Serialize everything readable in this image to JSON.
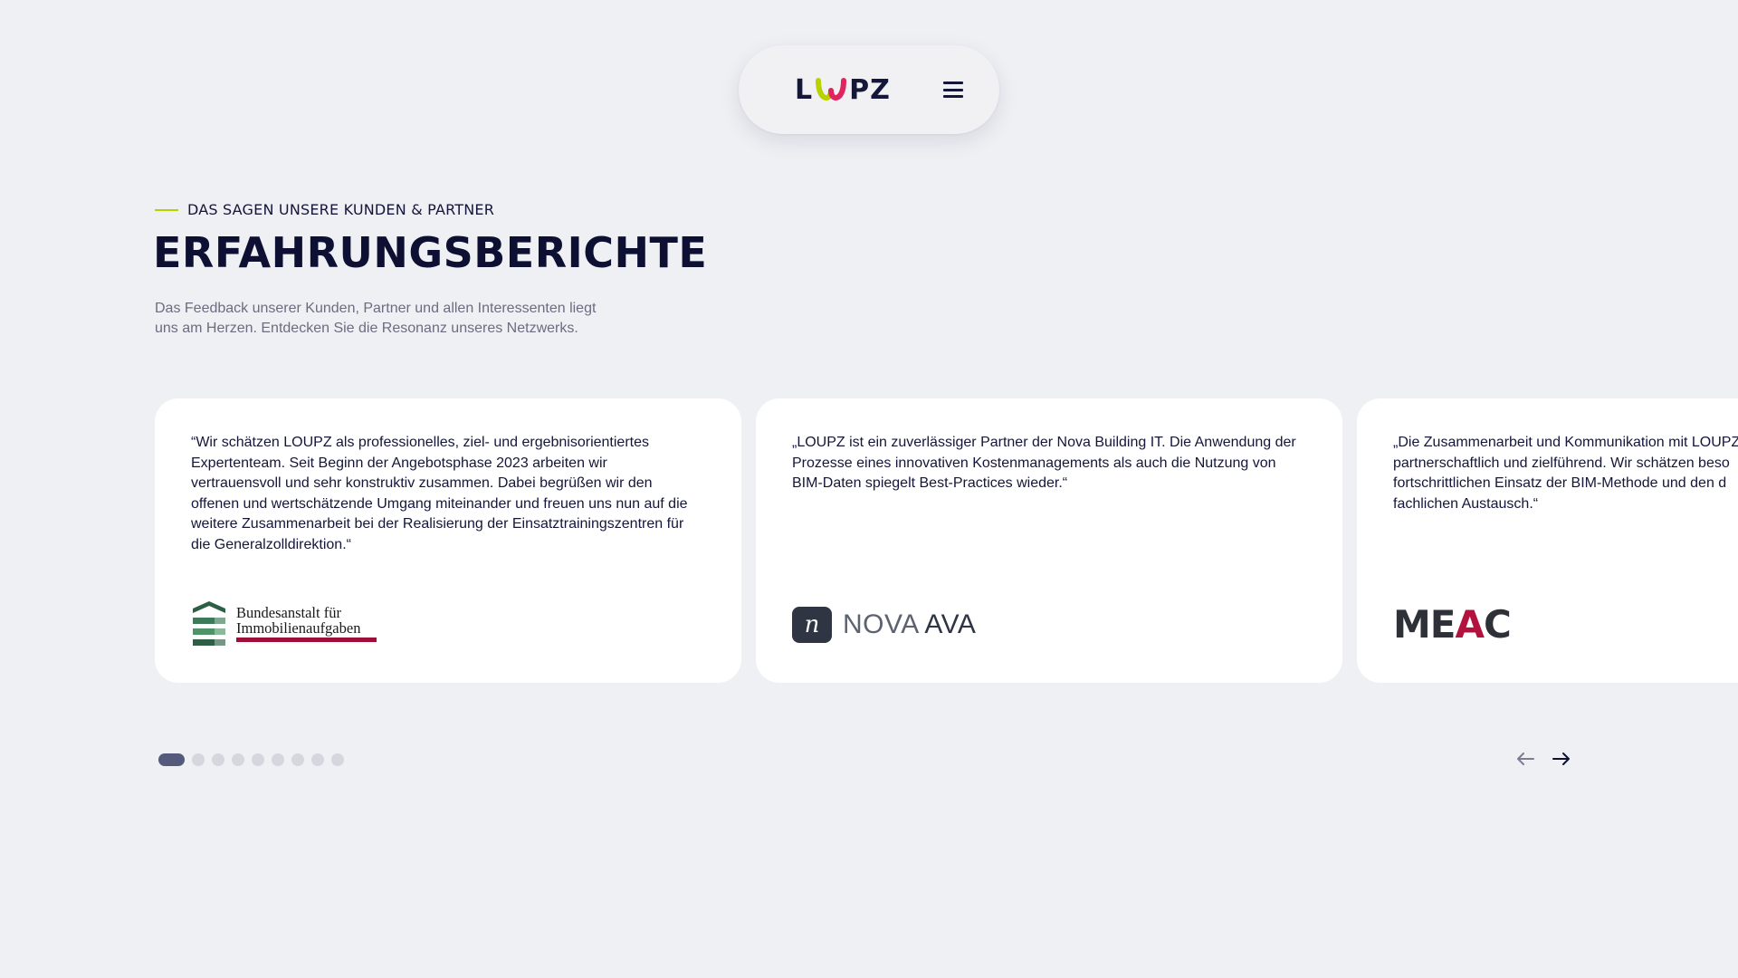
{
  "header": {
    "logo_text": "LOUPZ",
    "menu_icon": "hamburger-menu-icon"
  },
  "section": {
    "eyebrow": "DAS SAGEN UNSERE KUNDEN & PARTNER",
    "title": "ERFAHRUNGSBERICHTE",
    "intro": "Das Feedback unserer Kunden, Partner und allen Interessenten liegt uns am Herzen. Entdecken Sie die Resonanz unseres Netzwerks."
  },
  "testimonials": [
    {
      "quote": "“Wir schätzen LOUPZ als professionelles, ziel- und ergebnisorientiertes\nExpertenteam. Seit Beginn der Angebotsphase 2023 arbeiten wir\nvertrauensvoll und sehr konstruktiv zusammen. Dabei begrüßen wir den\noffenen und wertschätzende Umgang miteinander und freuen uns nun auf die\nweitere Zusammenarbeit bei der Realisierung der Einsatztrainingszentren für\ndie Generalzolldirektion.“",
      "partner_line1": "Bundesanstalt für",
      "partner_line2": "Immobilienaufgaben"
    },
    {
      "quote": "„LOUPZ ist ein zuverlässiger Partner der Nova Building IT. Die Anwendung der\nProzesse eines innovativen Kostenmanagements als auch die Nutzung von\nBIM-Daten spiegelt Best-Practices wieder.“",
      "partner_mark": "n",
      "partner_name_a": "NOVA",
      "partner_name_b": "AVA"
    },
    {
      "quote": "„Die Zusammenarbeit und Kommunikation mit LOUPZ\npartnerschaftlich und zielführend. Wir schätzen beso\nfortschrittlichen Einsatz der BIM-Methode und den d\nfachlichen Austausch.“",
      "partner_a": "ME",
      "partner_b": "A",
      "partner_c": "C"
    }
  ],
  "pagination": {
    "total": 9,
    "active": 1
  },
  "navigation": {
    "prev_icon": "arrow-left-icon",
    "next_icon": "arrow-right-icon"
  },
  "colors": {
    "background": "#eff0f4",
    "accent_green": "#b8d200",
    "navy": "#0e1033",
    "bima_red": "#9c0f38",
    "meac_red": "#b3123f"
  }
}
